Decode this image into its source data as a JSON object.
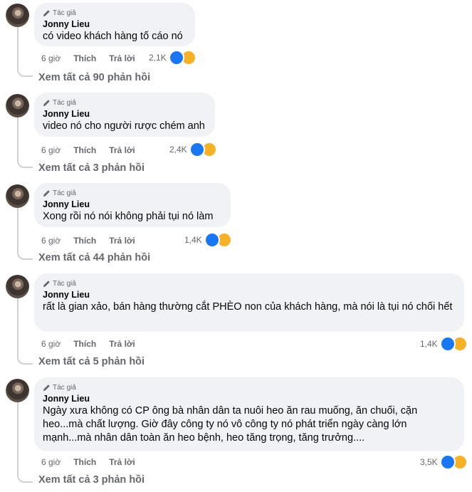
{
  "comments": [
    {
      "badge": "Tác giả",
      "name": "Jonny Lieu",
      "text": "có video khách hàng tố cáo nó",
      "time": "6 giờ",
      "like": "Thích",
      "reply": "Trả lời",
      "reactions": "2,1K",
      "see_all": "Xem tất cả 90 phản hồi"
    },
    {
      "badge": "Tác giả",
      "name": "Jonny Lieu",
      "text": "video nó cho người rược chém anh",
      "time": "6 giờ",
      "like": "Thích",
      "reply": "Trả lời",
      "reactions": "2,4K",
      "see_all": "Xem tất cả 3 phản hồi"
    },
    {
      "badge": "Tác giả",
      "name": "Jonny Lieu",
      "text": "Xong rồi nó nói không phải tụi nó làm",
      "time": "6 giờ",
      "like": "Thích",
      "reply": "Trả lời",
      "reactions": "1,4K",
      "see_all": "Xem tất cả 44 phản hồi"
    },
    {
      "badge": "Tác giả",
      "name": "Jonny Lieu",
      "text": "rất là gian xảo, bán hàng thường cắt PHÈO non của khách hàng, mà nói là tụi nó chối hết",
      "time": "6 giờ",
      "like": "Thích",
      "reply": "Trả lời",
      "reactions": "1,4K",
      "see_all": "Xem tất cả 5 phản hồi"
    },
    {
      "badge": "Tác giả",
      "name": "Jonny Lieu",
      "text": "Ngày xưa không có CP ông bà nhân dân ta nuôi heo ăn rau muống, ăn chuối, cặn heo...mà chất lượng. Giờ đây công ty nó vô công ty nó phát triển ngày càng lớn mạnh...mà nhân dân toàn ăn heo bệnh, heo tăng trọng, tăng trưởng....",
      "time": "6 giờ",
      "like": "Thích",
      "reply": "Trả lời",
      "reactions": "3,5K",
      "see_all": "Xem tất cả 3 phản hồi"
    }
  ],
  "colors": {
    "like": "#1877f2",
    "sad": "#f7b125",
    "bubble": "#f0f2f5",
    "meta": "#65676b"
  },
  "icons": {
    "badge": "pencil-icon",
    "like": "like-reaction-icon",
    "sad": "sad-reaction-icon"
  }
}
